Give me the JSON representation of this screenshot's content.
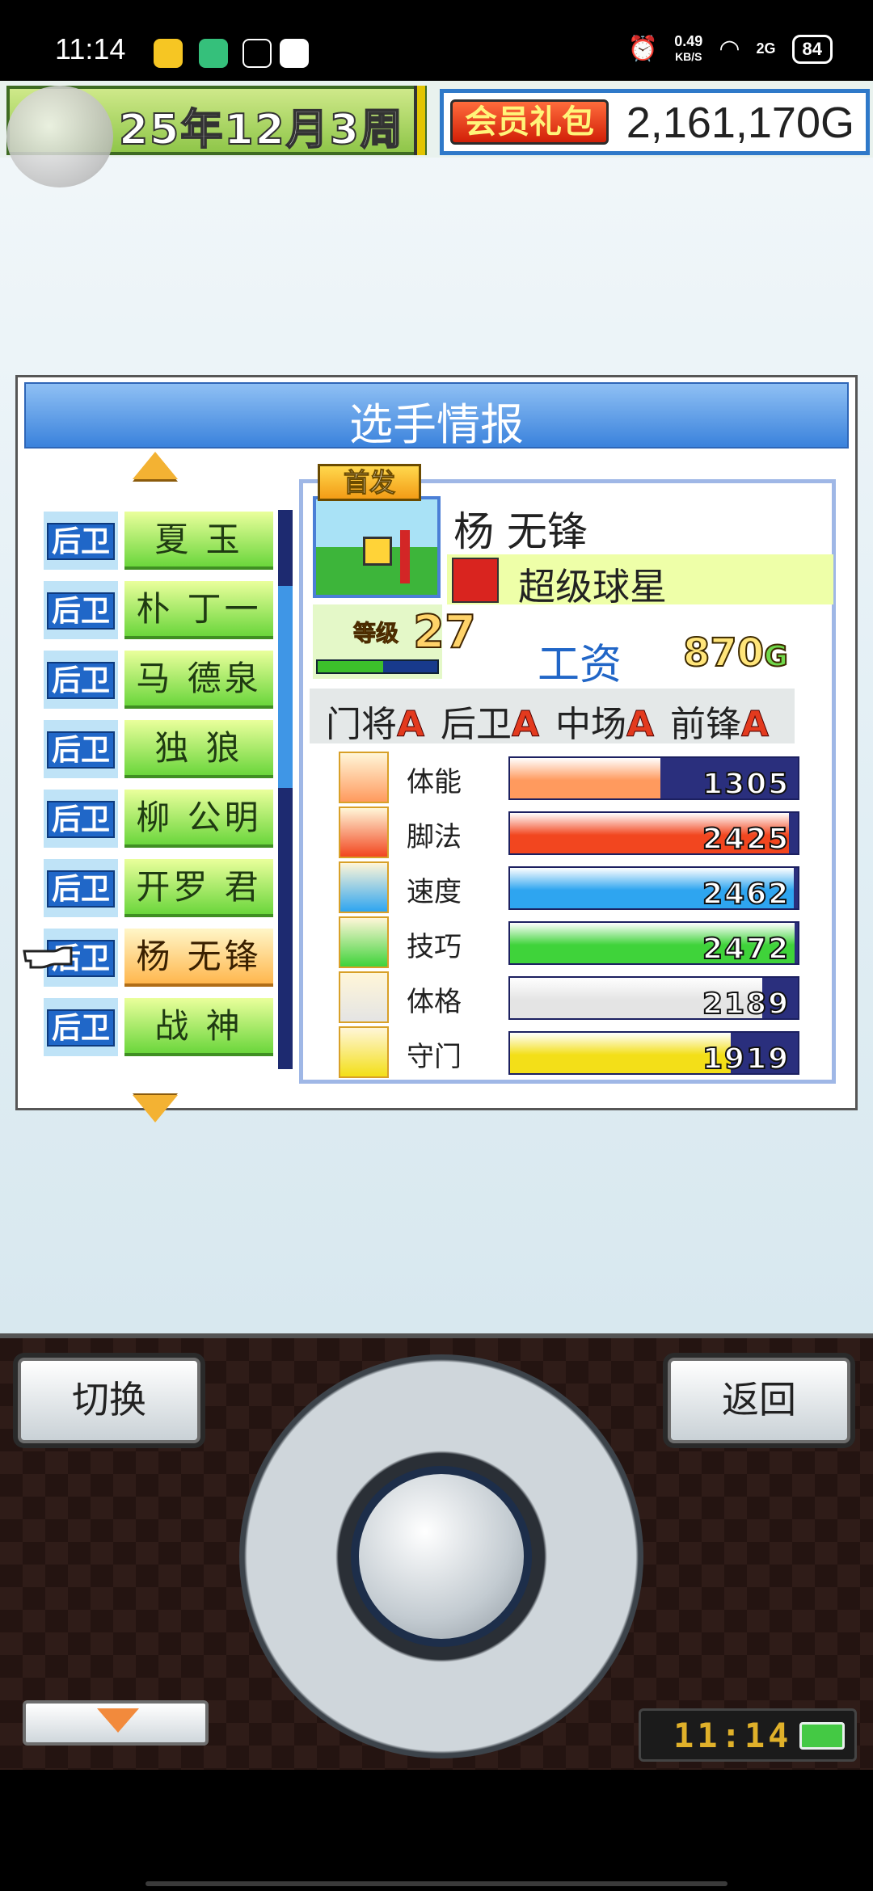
{
  "status_bar": {
    "time": "11:14",
    "net_speed_value": "0.49",
    "net_speed_unit": "KB/S",
    "signal_label": "2G",
    "battery": "84"
  },
  "header": {
    "date_text": "25年12月3周",
    "vip_label": "会员礼包",
    "gold": "2,161,170G"
  },
  "panel": {
    "title": "选手情报"
  },
  "roster": [
    {
      "position": "后卫",
      "name": "夏 玉",
      "selected": false
    },
    {
      "position": "后卫",
      "name": "朴 丁一",
      "selected": false
    },
    {
      "position": "后卫",
      "name": "马 德泉",
      "selected": false
    },
    {
      "position": "后卫",
      "name": "独 狼",
      "selected": false
    },
    {
      "position": "后卫",
      "name": "柳 公明",
      "selected": false
    },
    {
      "position": "后卫",
      "name": "开罗 君",
      "selected": false
    },
    {
      "position": "后卫",
      "name": "杨 无锋",
      "selected": true
    },
    {
      "position": "后卫",
      "name": "战 神",
      "selected": false
    }
  ],
  "player": {
    "badge": "首发",
    "name": "杨 无锋",
    "title": "超级球星",
    "level_label": "等级",
    "level": "27",
    "salary_label": "工资",
    "salary": "870",
    "salary_unit": "G",
    "exp_fraction": 0.55,
    "positions": [
      {
        "label": "门将",
        "grade": "A"
      },
      {
        "label": "后卫",
        "grade": "A"
      },
      {
        "label": "中场",
        "grade": "A"
      },
      {
        "label": "前锋",
        "grade": "A"
      }
    ],
    "stats": [
      {
        "name": "体能",
        "value": "1305",
        "color": "#ff9a5e",
        "icon": "battery-icon"
      },
      {
        "name": "脚法",
        "value": "2425",
        "color": "#f2461f",
        "icon": "boot-icon"
      },
      {
        "name": "速度",
        "value": "2462",
        "color": "#2ea5f0",
        "icon": "runner-icon"
      },
      {
        "name": "技巧",
        "value": "2472",
        "color": "#3fd33a",
        "icon": "dribble-icon"
      },
      {
        "name": "体格",
        "value": "2189",
        "color": "#e4e4e4",
        "icon": "muscle-icon"
      },
      {
        "name": "守门",
        "value": "1919",
        "color": "#f3df18",
        "icon": "glove-icon"
      }
    ]
  },
  "controls": {
    "switch_label": "切换",
    "back_label": "返回",
    "clock": "11:14"
  }
}
